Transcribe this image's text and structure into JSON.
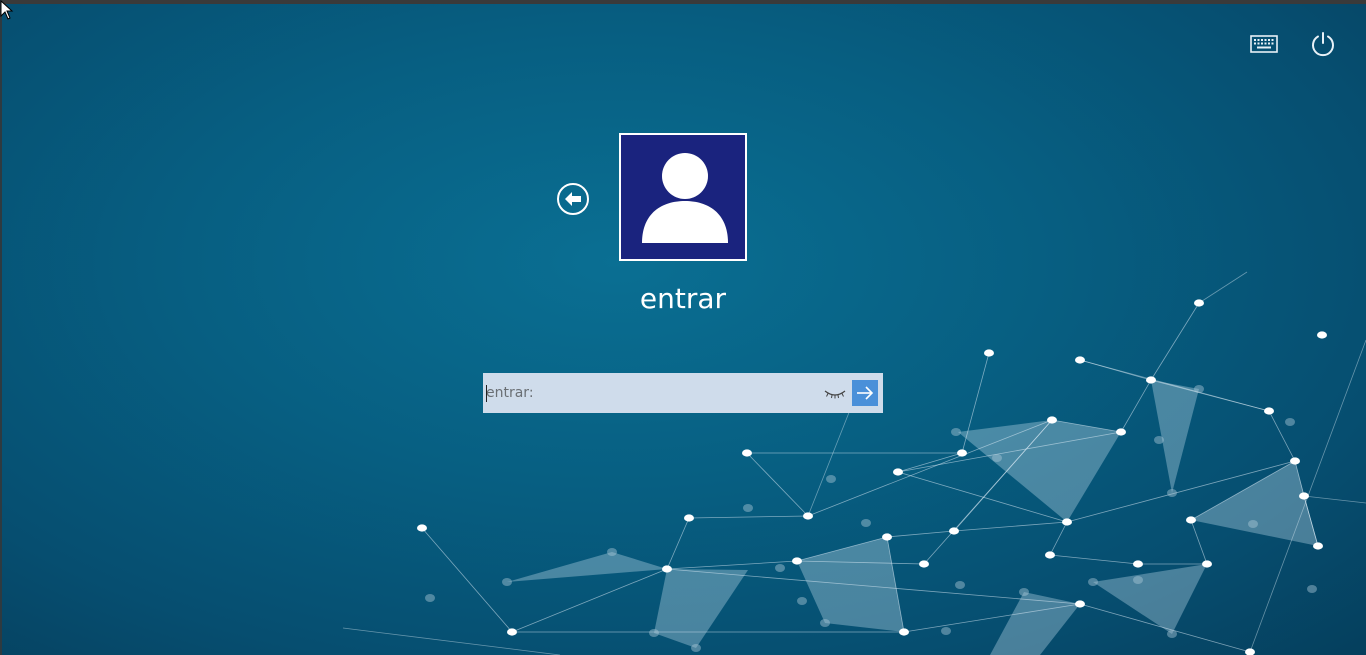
{
  "login": {
    "username": "entrar",
    "password_placeholder": "entrar:",
    "password_value": ""
  },
  "icons": {
    "keyboard": "keyboard-icon",
    "power": "power-icon",
    "back": "back-arrow-icon",
    "avatar": "user-avatar-icon",
    "reveal": "eye-closed-icon",
    "submit": "arrow-right-icon",
    "cursor": "mouse-cursor-icon"
  },
  "colors": {
    "background": "#075f82",
    "avatar_bg": "#1a237e",
    "input_bg": "#cfdceb",
    "submit_bg": "#4a90d9"
  }
}
